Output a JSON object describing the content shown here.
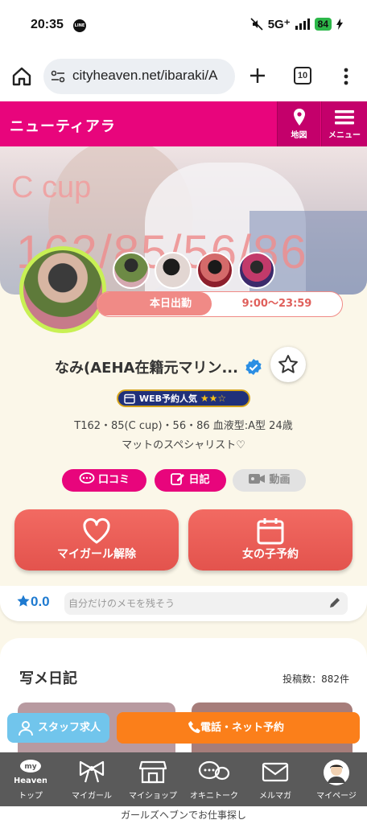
{
  "status_bar": {
    "time": "20:35",
    "network": "5G⁺",
    "battery": "84"
  },
  "browser": {
    "url": "cityheaven.net/ibaraki/A",
    "tab_count": "10"
  },
  "shop": {
    "name": "ニューティアラ",
    "map_label": "地図",
    "menu_label": "メニュー"
  },
  "hero": {
    "cup_text": "C cup",
    "measurements": "162/85/56/86"
  },
  "schedule": {
    "label": "本日出勤",
    "time": "9:00〜23:59"
  },
  "profile": {
    "name": "なみ(AEHA在籍元マリン...",
    "badge_text": "WEB予約人気",
    "badge_stars": "★★☆",
    "stats": "T162・85(C cup)・56・86  血液型:A型  24歳",
    "catchphrase": "マットのスペシャリスト♡"
  },
  "actions": {
    "kuchikomi": "口コミ",
    "diary": "日記",
    "video": "動画",
    "my_girl_remove": "マイガール解除",
    "girl_reserve": "女の子予約"
  },
  "memo": {
    "rating": "0.0",
    "placeholder": "自分だけのメモを残そう"
  },
  "diary_section": {
    "title": "写メ日記",
    "count": "投稿数：882件"
  },
  "floating": {
    "staff": "スタッフ求人",
    "reserve": "電話・ネット予約"
  },
  "bottom_nav": {
    "my_heaven_logo": "my Heaven",
    "items": [
      "トップ",
      "マイガール",
      "マイショップ",
      "オキニトーク",
      "メルマガ",
      "マイページ"
    ]
  },
  "footer": "ガールズヘブンでお仕事探し",
  "colors": {
    "brand_pink": "#e8057c",
    "coral": "#f08a86",
    "orange": "#fb7f1a",
    "sky": "#71c5ec",
    "nav_gray": "#5a5a5a"
  }
}
